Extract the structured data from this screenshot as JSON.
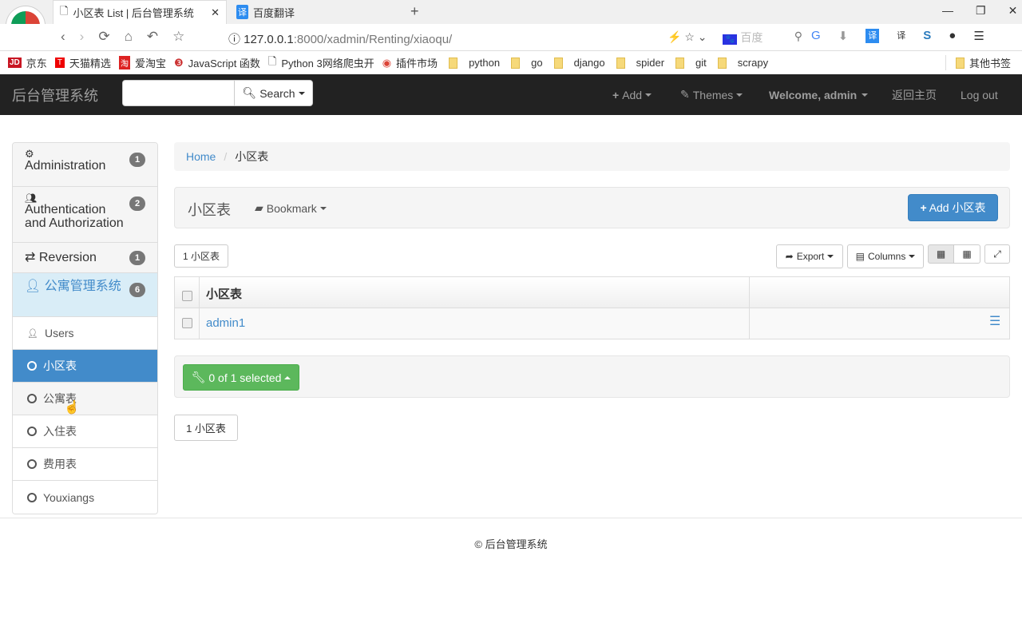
{
  "browser": {
    "tabs": [
      {
        "title": "小区表 List | 后台管理系统"
      },
      {
        "title": "百度翻译",
        "icon": "译"
      }
    ],
    "url_host": "127.0.0.1",
    "url_rest": ":8000/xadmin/Renting/xiaoqu/",
    "search_placeholder": "百度",
    "bookmarks": [
      "京东",
      "天猫精选",
      "爱淘宝",
      "JavaScript 函数",
      "Python 3网络爬虫开",
      "插件市场",
      "python",
      "go",
      "django",
      "spider",
      "git",
      "scrapy"
    ],
    "other_bookmarks": "其他书签"
  },
  "header": {
    "brand": "后台管理系统",
    "search_button": "Search",
    "add": "Add",
    "themes": "Themes",
    "welcome": "Welcome, admin",
    "home": "返回主页",
    "logout": "Log out"
  },
  "sidebar": {
    "groups": [
      {
        "label": "Administration",
        "count": "1"
      },
      {
        "label": "Authentication and Authorization",
        "count": "2"
      },
      {
        "label": "Reversion",
        "count": "1"
      },
      {
        "label": "公寓管理系统",
        "count": "6"
      }
    ],
    "items": [
      {
        "label": "Users"
      },
      {
        "label": "小区表"
      },
      {
        "label": "公寓表"
      },
      {
        "label": "入住表"
      },
      {
        "label": "费用表"
      },
      {
        "label": "Youxiangs"
      }
    ]
  },
  "breadcrumb": {
    "home": "Home",
    "current": "小区表"
  },
  "main": {
    "title": "小区表",
    "bookmark": "Bookmark",
    "add_button": "Add 小区表",
    "count_label": "1 小区表",
    "export": "Export",
    "columns": "Columns",
    "table": {
      "header": "小区表",
      "rows": [
        {
          "name": "admin1"
        }
      ]
    },
    "selected": "0 of 1 selected",
    "pagination": "1 小区表"
  },
  "footer": "© 后台管理系统",
  "colors": {
    "primary": "#428bca",
    "success": "#5cb85c",
    "navbar": "#222222"
  }
}
